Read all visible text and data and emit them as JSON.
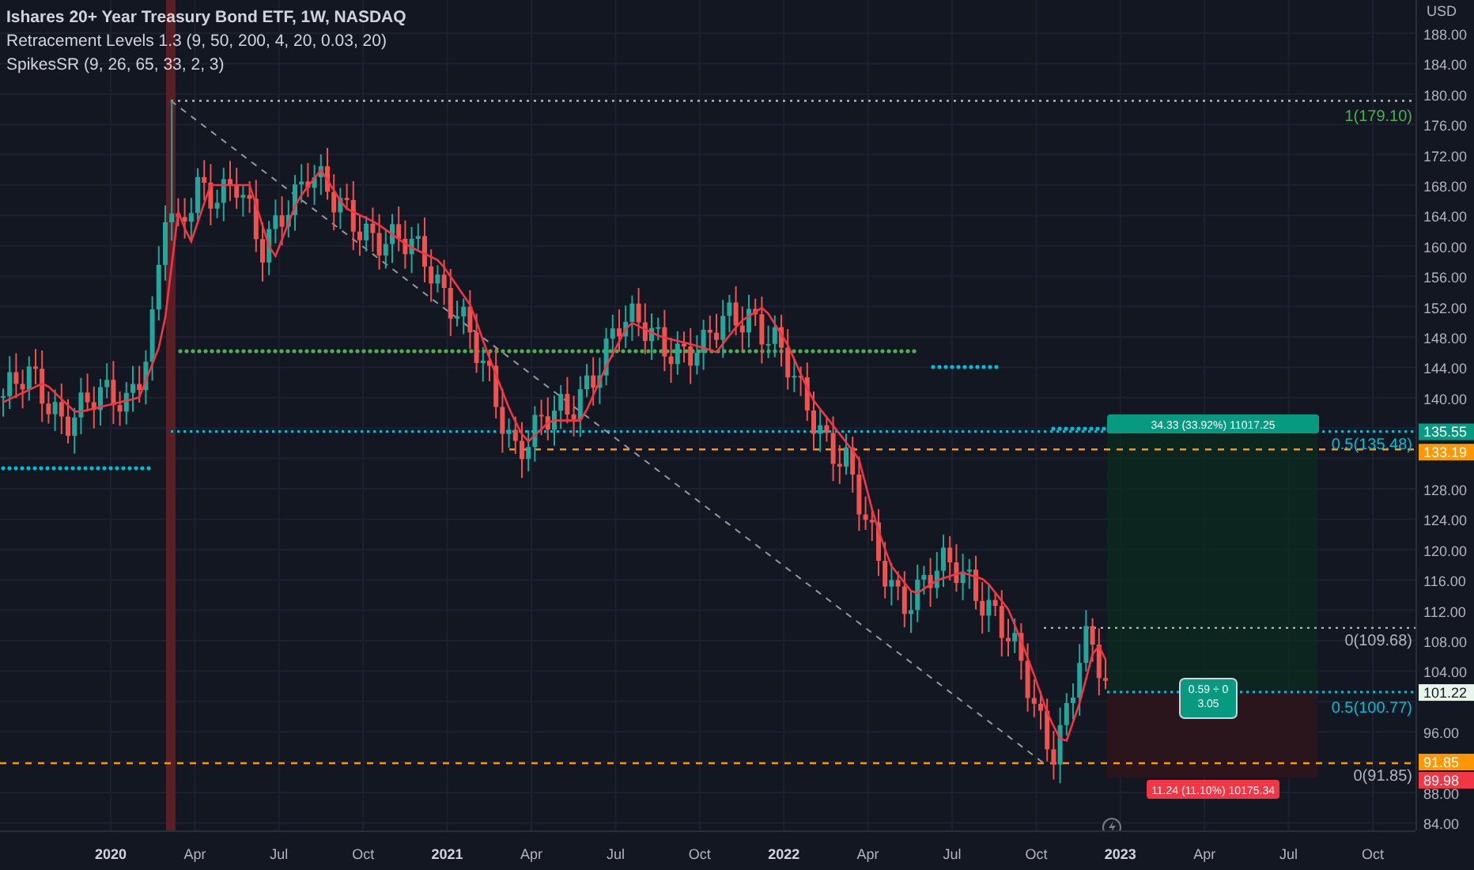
{
  "legend": [
    "Ishares 20+ Year Treasury Bond ETF, 1W, NASDAQ",
    "Retracement Levels 1.3 (9, 50, 200, 4, 20, 0.03, 20)",
    "SpikesSR (9, 26, 65, 33, 2, 3)"
  ],
  "price_axis": {
    "currency": "USD",
    "ticks": [
      "188.00",
      "184.00",
      "180.00",
      "176.00",
      "172.00",
      "168.00",
      "164.00",
      "160.00",
      "156.00",
      "152.00",
      "148.00",
      "144.00",
      "140.00",
      "128.00",
      "124.00",
      "120.00",
      "116.00",
      "112.00",
      "108.00",
      "104.00",
      "96.00",
      "88.00",
      "84.00"
    ],
    "badges": [
      {
        "text": "135.55",
        "color": "#089981"
      },
      {
        "text": "133.19",
        "color": "#ff9800"
      },
      {
        "text": "101.22",
        "color": "#e8f5e9"
      },
      {
        "text": "91.85",
        "color": "#ff9800"
      },
      {
        "text": "89.98",
        "color": "#f23645"
      }
    ]
  },
  "fib_labels": [
    {
      "text": "1(179.10)",
      "color": "#4caf50"
    },
    {
      "text": "0.5(135.48)",
      "color": "#00bcd4"
    },
    {
      "text": "0(109.68)",
      "color": "#b2b5be"
    },
    {
      "text": "0.5(100.77)",
      "color": "#00bcd4"
    },
    {
      "text": "0(91.85)",
      "color": "#b2b5be"
    }
  ],
  "position": {
    "profit_label": "34.33 (33.92%) 11017.25",
    "loss_label": "11.24 (11.10%) 10175.34",
    "ratio_lines": [
      "0.59 ÷ 0",
      "3.05"
    ]
  },
  "time_axis": [
    {
      "text": "2020",
      "kind": "year"
    },
    {
      "text": "Apr",
      "kind": "month"
    },
    {
      "text": "Jul",
      "kind": "month"
    },
    {
      "text": "Oct",
      "kind": "month"
    },
    {
      "text": "2021",
      "kind": "year"
    },
    {
      "text": "Apr",
      "kind": "month"
    },
    {
      "text": "Jul",
      "kind": "month"
    },
    {
      "text": "Oct",
      "kind": "month"
    },
    {
      "text": "2022",
      "kind": "year"
    },
    {
      "text": "Apr",
      "kind": "month"
    },
    {
      "text": "Jul",
      "kind": "month"
    },
    {
      "text": "Oct",
      "kind": "month"
    },
    {
      "text": "2023",
      "kind": "year"
    },
    {
      "text": "Apr",
      "kind": "month"
    },
    {
      "text": "Jul",
      "kind": "month"
    },
    {
      "text": "Oct",
      "kind": "month"
    }
  ]
}
